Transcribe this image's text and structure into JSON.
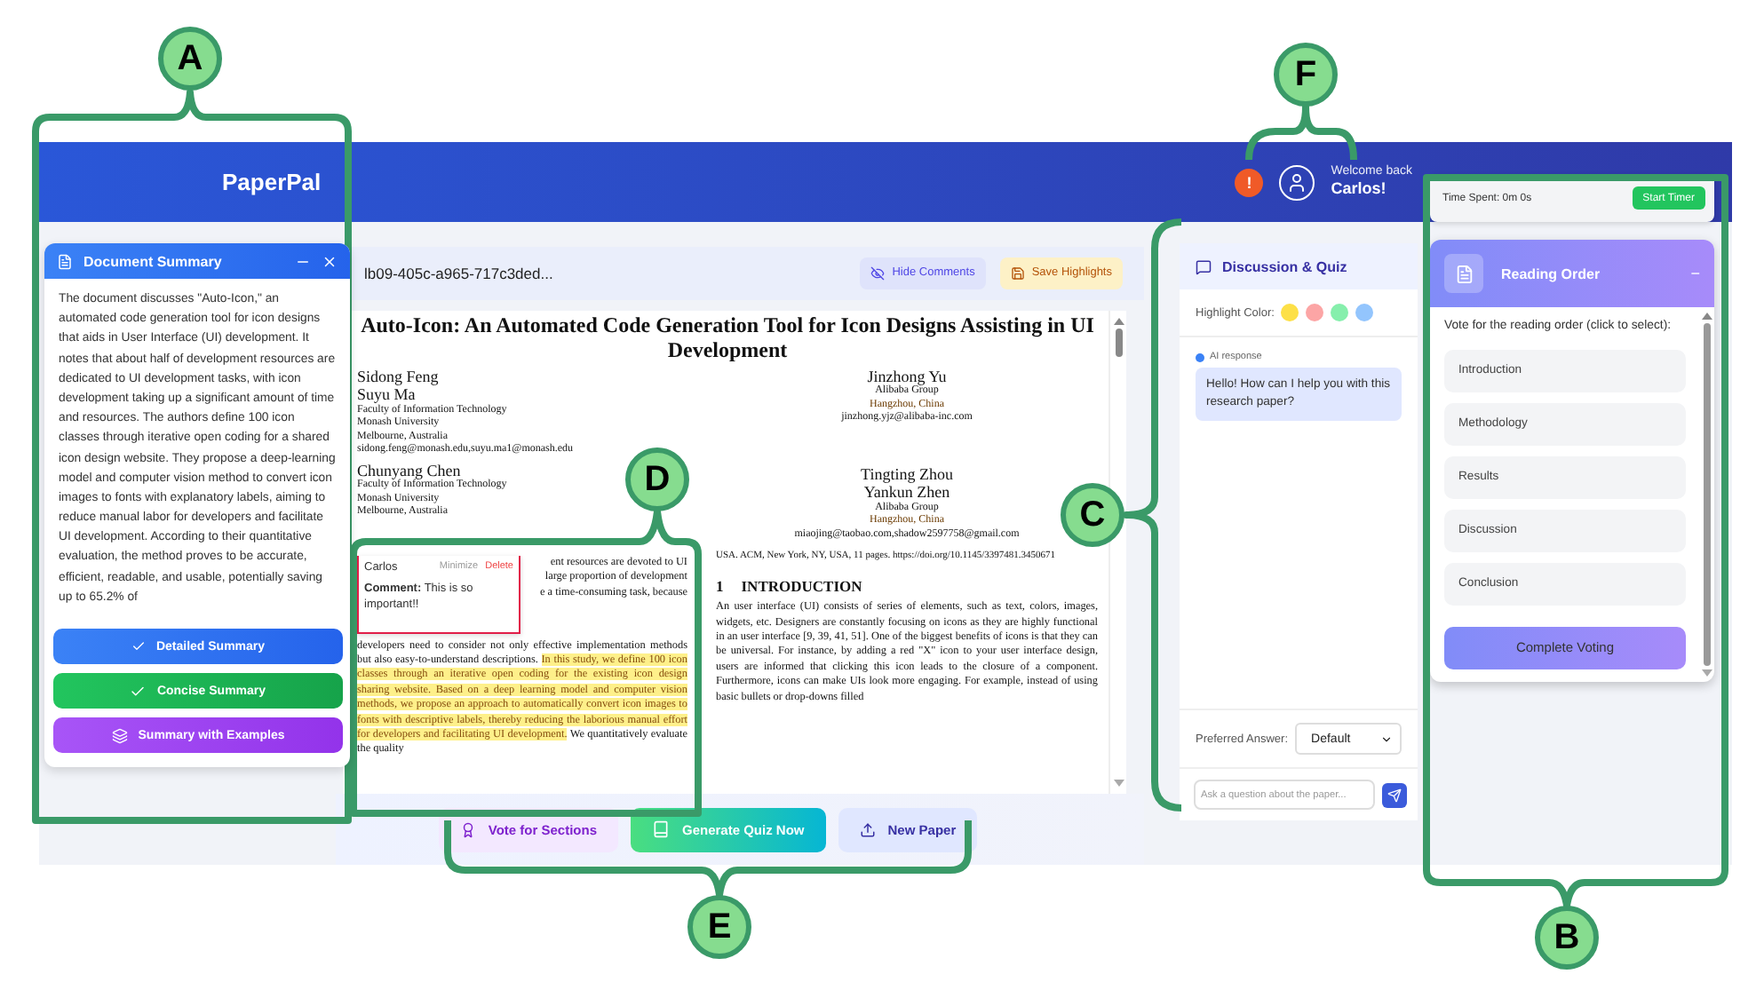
{
  "header": {
    "title": "PaperPal",
    "alert": "!",
    "welcome": "Welcome back",
    "user": "Carlos!"
  },
  "summary_panel": {
    "title": "Document Summary",
    "text": "The document discusses \"Auto-Icon,\" an automated code generation tool for icon designs that aids in User Interface (UI) development. It notes that about half of development resources are dedicated to UI development tasks, with icon development taking up a significant amount of time and resources. The authors define 100 icon classes through iterative open coding for a shared icon design website. They propose a deep-learning model and computer vision method to convert icon images to fonts with explanatory labels, aiming to reduce manual labor for developers and facilitate UI development. According to their quantitative evaluation, the method proves to be accurate, efficient, readable, and usable, potentially saving up to 65.2% of",
    "buttons": [
      {
        "label": "Detailed Summary",
        "kind": "detailed"
      },
      {
        "label": "Concise Summary",
        "kind": "concise"
      },
      {
        "label": "Summary with Examples",
        "kind": "examples"
      }
    ]
  },
  "document": {
    "file_name": "lb09-405c-a965-717c3ded...",
    "actions": [
      {
        "label": "Hide Comments",
        "kind": "hide"
      },
      {
        "label": "Save Highlights",
        "kind": "save"
      }
    ],
    "title": "Auto-Icon: An Automated Code Generation Tool for Icon Designs Assisting in UI Development",
    "authors_left": [
      [
        "Sidong Feng",
        "Suyu Ma",
        "Faculty of Information Technology",
        "Monash University",
        "Melbourne, Australia",
        "sidong.feng@monash.edu,suyu.ma1@monash.edu"
      ],
      [
        "Chunyang Chen",
        "Faculty of Information Technology",
        "Monash University",
        "Melbourne, Australia"
      ]
    ],
    "authors_right": [
      [
        "Jinzhong Yu",
        "Alibaba Group",
        "Hangzhou, China",
        "jinzhong.yjz@alibaba-inc.com"
      ],
      [
        "Tingting Zhou",
        "Yankun Zhen",
        "Alibaba Group",
        "Hangzhou, China",
        "miaojing@taobao.com,shadow2597758@gmail.com"
      ]
    ],
    "comment": {
      "author": "Carlos",
      "minimize": "Minimize",
      "delete": "Delete",
      "text": "**Comment:** This is so important!!"
    },
    "abstract": {
      "fragments": [
        "ent resources are devoted to UI",
        "large proportion of development",
        "e a time-consuming task, because"
      ],
      "before": "developers need to consider not only effective implementation methods but also easy-to-understand descriptions. ",
      "highlight": "In this study, we define 100 icon classes through an iterative open coding for the existing icon design sharing website. Based on a deep learning model and computer vision methods, we propose an approach to automatically convert icon images to fonts with descriptive labels, thereby reducing the laborious manual effort for developers and facilitating UI development.",
      "after": " We quantitatively evaluate the quality"
    },
    "reference": "USA. ACM, New York, NY, USA, 11 pages. https://doi.org/10.1145/3397481.3450671",
    "section_number": "1",
    "section_title": "INTRODUCTION",
    "intro": "An user interface (UI) consists of series of elements, such as text, colors, images, widgets, etc. Designers are constantly focusing on icons as they are highly functional in an user interface [9, 39, 41, 51]. One of the biggest benefits of icons is that they can be universal. For instance, by adding a red \"X\" icon to your user interface design, users are informed that clicking this icon leads to the closure of a component. Furthermore, icons can make UIs look more engaging. For example, instead of using basic bullets or drop-downs filled"
  },
  "bottom_actions": [
    {
      "label": "Vote for Sections",
      "kind": "vote"
    },
    {
      "label": "Generate Quiz Now",
      "kind": "quiz"
    },
    {
      "label": "New Paper",
      "kind": "new"
    }
  ],
  "discussion": {
    "title": "Discussion & Quiz",
    "highlight_label": "Highlight Color:",
    "colors": [
      {
        "color": "#fde047"
      },
      {
        "color": "#fca5a5"
      },
      {
        "color": "#86efac"
      },
      {
        "color": "#93c5fd"
      }
    ],
    "message_label": "AI response",
    "message": "Hello! How can I help you with this research paper?",
    "preferred_label": "Preferred Answer:",
    "preferred_value": "Default",
    "placeholder": "Ask a question about the paper..."
  },
  "reading_panel": {
    "time_spent": "Time Spent: 0m 0s",
    "timer_button": "Start Timer",
    "title": "Reading Order",
    "collapse": "−",
    "prompt": "Vote for the reading order (click to select):",
    "items": [
      {
        "label": "Introduction",
        "selected": false
      },
      {
        "label": "Methodology",
        "selected": false
      },
      {
        "label": "Results",
        "selected": false
      },
      {
        "label": "Discussion",
        "selected": false
      },
      {
        "label": "Conclusion",
        "selected": false
      }
    ],
    "complete": "Complete Voting"
  },
  "callouts": [
    {
      "letter": "A"
    },
    {
      "letter": "F"
    },
    {
      "letter": "D"
    },
    {
      "letter": "C"
    },
    {
      "letter": "E"
    },
    {
      "letter": "B"
    }
  ]
}
